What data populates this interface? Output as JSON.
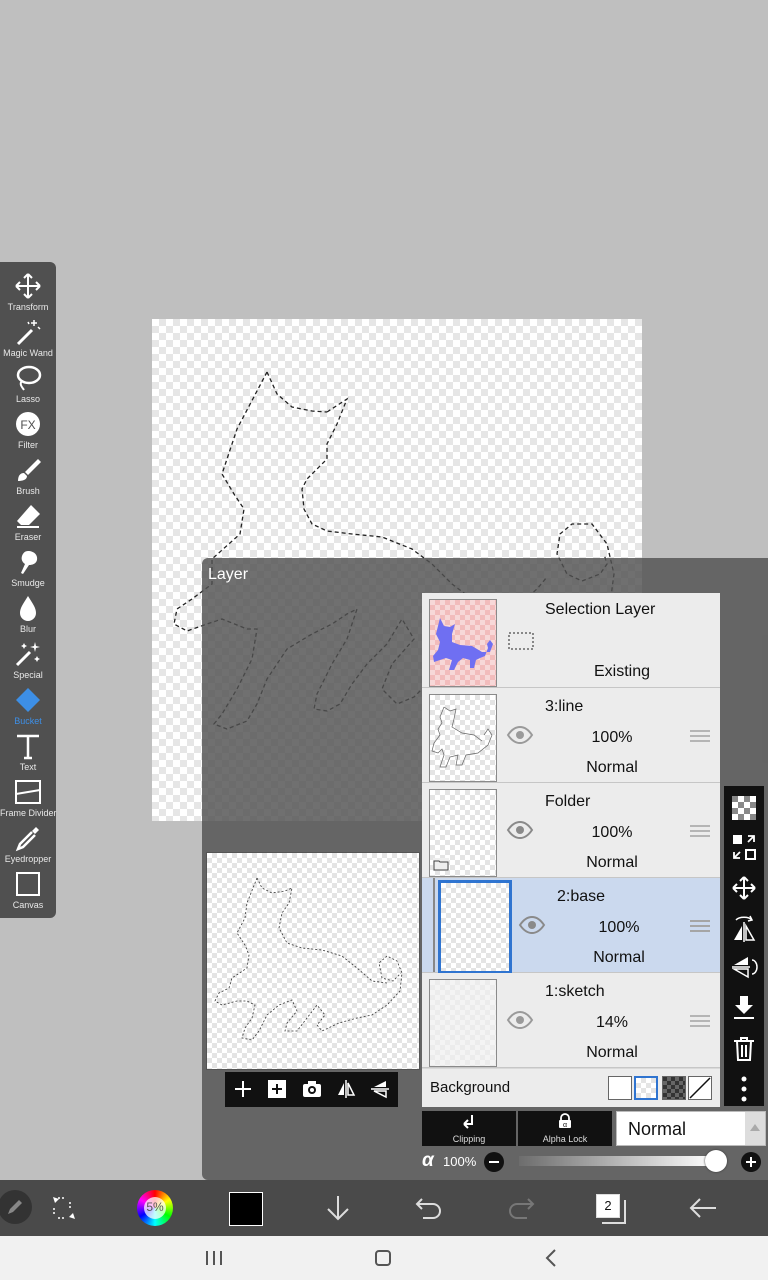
{
  "tools": [
    {
      "label": "Transform",
      "icon": "move-arrows-icon"
    },
    {
      "label": "Magic Wand",
      "icon": "magic-wand-icon"
    },
    {
      "label": "Lasso",
      "icon": "lasso-icon"
    },
    {
      "label": "Filter",
      "icon": "fx-icon"
    },
    {
      "label": "Brush",
      "icon": "brush-icon"
    },
    {
      "label": "Eraser",
      "icon": "eraser-icon"
    },
    {
      "label": "Smudge",
      "icon": "smudge-icon"
    },
    {
      "label": "Blur",
      "icon": "blur-drop-icon"
    },
    {
      "label": "Special",
      "icon": "special-sparkle-icon"
    },
    {
      "label": "Bucket",
      "icon": "bucket-icon",
      "active": true
    },
    {
      "label": "Text",
      "icon": "text-icon"
    },
    {
      "label": "Frame Divider",
      "icon": "frame-divider-icon"
    },
    {
      "label": "Eyedropper",
      "icon": "eyedropper-icon"
    },
    {
      "label": "Canvas",
      "icon": "canvas-icon"
    }
  ],
  "layer_panel": {
    "title": "Layer",
    "selection_layer": {
      "name": "Selection Layer",
      "status": "Existing"
    },
    "layers": [
      {
        "name": "3:line",
        "opacity": "100%",
        "mode": "Normal"
      },
      {
        "name": "Folder",
        "opacity": "100%",
        "mode": "Normal"
      },
      {
        "name": "2:base",
        "opacity": "100%",
        "mode": "Normal",
        "selected": true
      },
      {
        "name": "1:sketch",
        "opacity": "14%",
        "mode": "Normal"
      }
    ],
    "background_label": "Background",
    "clipping_label": "Clipping",
    "alpha_lock_label": "Alpha Lock",
    "blend_mode": "Normal",
    "opacity_symbol": "α",
    "opacity_value": "100%",
    "opacity_level": 1.0
  },
  "bottom_bar": {
    "color_wheel_label": "5%",
    "current_color": "#000000",
    "layer_count": "2"
  },
  "colors": {
    "accent": "#3d8fe6",
    "selected_row": "#cbd9ee",
    "foreground": "#000000"
  }
}
